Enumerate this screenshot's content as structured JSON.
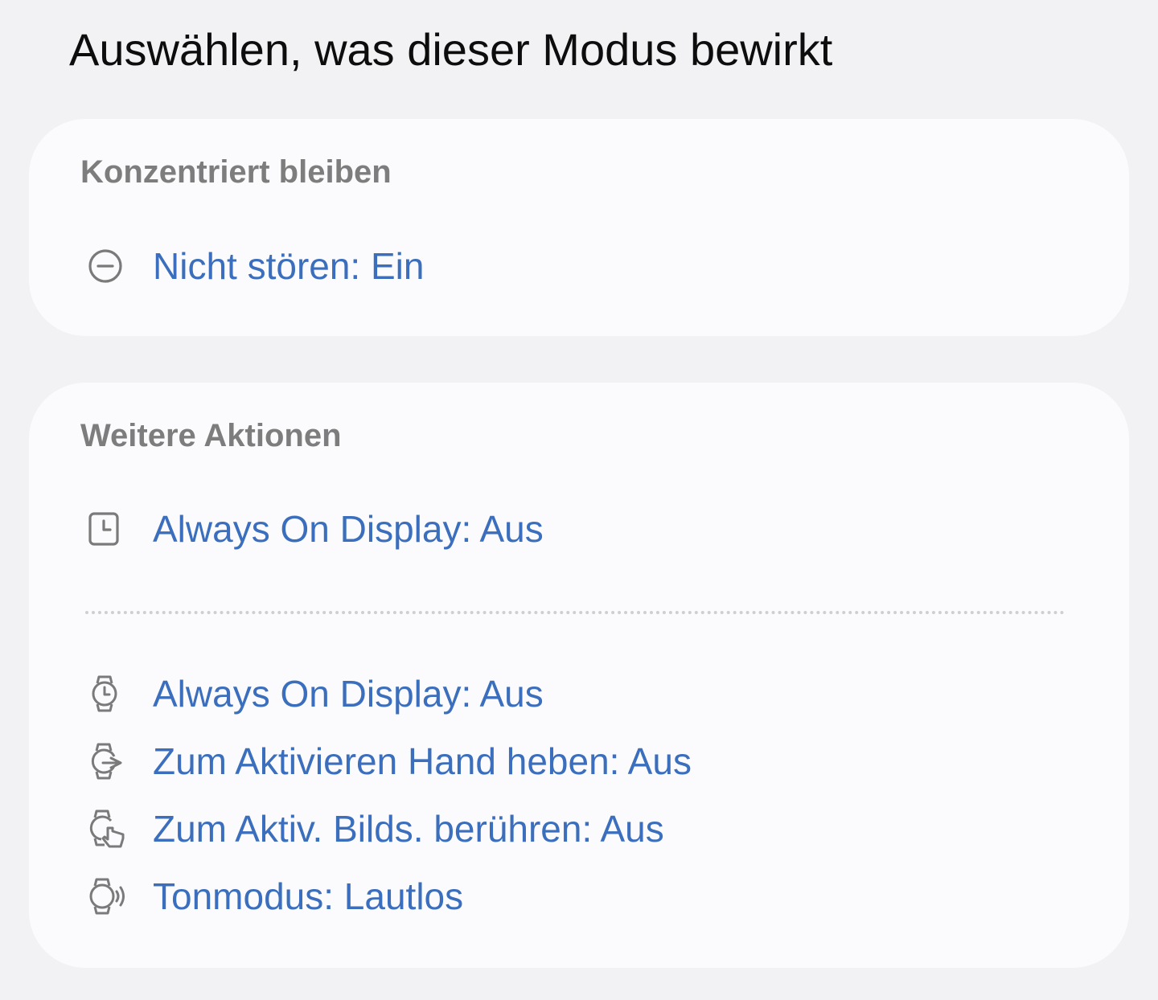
{
  "page": {
    "title": "Auswählen, was dieser Modus bewirkt"
  },
  "sections": [
    {
      "header": "Konzentriert bleiben",
      "items": [
        {
          "icon": "do-not-disturb-icon",
          "label": "Nicht stören: Ein"
        }
      ]
    },
    {
      "header": "Weitere Aktionen",
      "phone_items": [
        {
          "icon": "phone-clock-icon",
          "label": "Always On Display: Aus"
        }
      ],
      "watch_items": [
        {
          "icon": "watch-icon",
          "label": "Always On Display: Aus"
        },
        {
          "icon": "watch-raise-hand-icon",
          "label": "Zum Aktivieren Hand heben: Aus"
        },
        {
          "icon": "watch-touch-icon",
          "label": "Zum Aktiv. Bilds. berühren: Aus"
        },
        {
          "icon": "watch-sound-icon",
          "label": "Tonmodus: Lautlos"
        }
      ]
    }
  ],
  "colors": {
    "background": "#f2f2f4",
    "card": "#fbfbfd",
    "accent_text": "#3b6fbd",
    "header_text": "#7d7d7d",
    "icon": "#7a7a7a"
  }
}
